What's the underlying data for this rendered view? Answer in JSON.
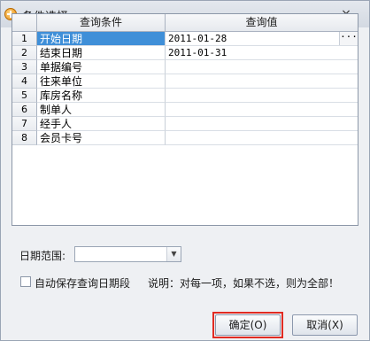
{
  "window": {
    "title": "条件选择",
    "close_glyph": "×"
  },
  "grid": {
    "columns": [
      "查询条件",
      "查询值"
    ],
    "rows": [
      {
        "num": "1",
        "condition": "开始日期",
        "value": "2011-01-28",
        "selected": true,
        "has_ellipsis": true
      },
      {
        "num": "2",
        "condition": "结束日期",
        "value": "2011-01-31"
      },
      {
        "num": "3",
        "condition": "单据编号",
        "value": ""
      },
      {
        "num": "4",
        "condition": "往来单位",
        "value": ""
      },
      {
        "num": "5",
        "condition": "库房名称",
        "value": ""
      },
      {
        "num": "6",
        "condition": "制单人",
        "value": ""
      },
      {
        "num": "7",
        "condition": "经手人",
        "value": ""
      },
      {
        "num": "8",
        "condition": "会员卡号",
        "value": ""
      }
    ],
    "ellipsis": "···"
  },
  "date_range": {
    "label": "日期范围:",
    "value": ""
  },
  "auto_save": {
    "label": "自动保存查询日期段",
    "checked": false
  },
  "hint": "说明：对每一项，如果不选，则为全部！",
  "buttons": {
    "ok": "确定(O)",
    "cancel": "取消(X)"
  },
  "colors": {
    "selection": "#3f8fd8",
    "focus_outline": "#e12b22"
  }
}
